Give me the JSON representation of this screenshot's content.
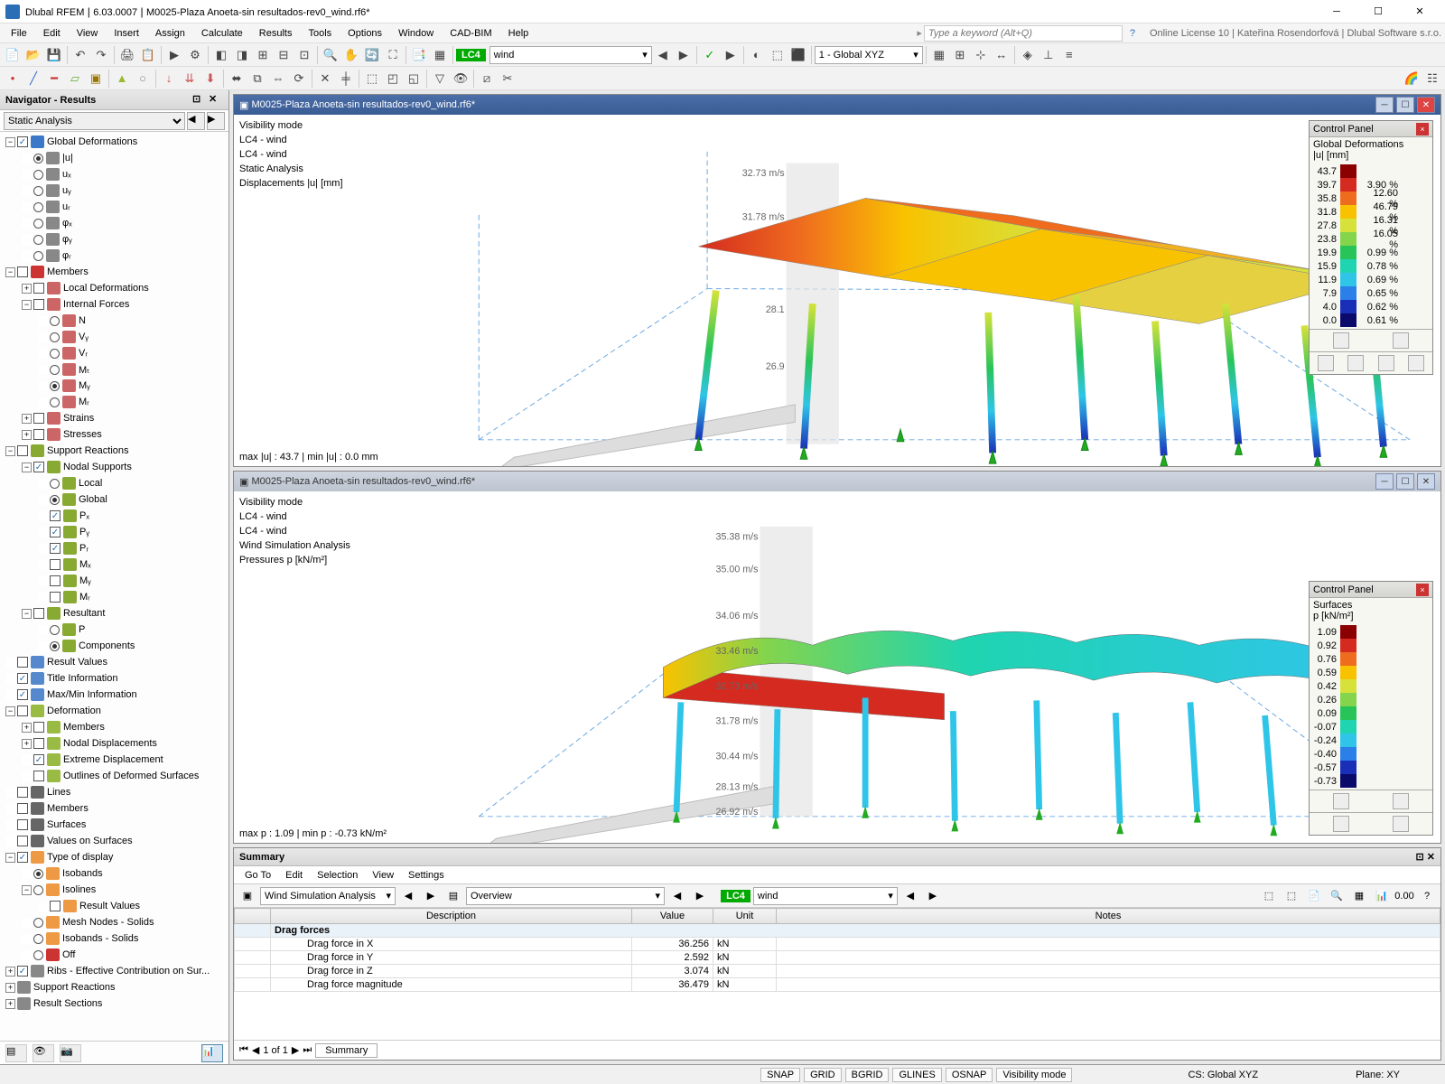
{
  "titlebar": {
    "app": "Dlubal RFEM",
    "version": "6.03.0007",
    "file": "M0025-Plaza Anoeta-sin resultados-rev0_wind.rf6*"
  },
  "menus": [
    "File",
    "Edit",
    "View",
    "Insert",
    "Assign",
    "Calculate",
    "Results",
    "Tools",
    "Options",
    "Window",
    "CAD-BIM",
    "Help"
  ],
  "search_placeholder": "Type a keyword (Alt+Q)",
  "license": "Online License 10 | Kateřina Rosendorfová | Dlubal Software s.r.o.",
  "toolbar1": {
    "lc_num": "LC4",
    "lc_name": "wind",
    "global": "1 - Global XYZ"
  },
  "navigator": {
    "title": "Navigator - Results",
    "combo": "Static Analysis",
    "tree": [
      {
        "d": 0,
        "exp": "-",
        "cb": "on",
        "ic": "#3c78c8",
        "lbl": "Global Deformations"
      },
      {
        "d": 1,
        "rb": "on",
        "ic": "#888",
        "lbl": "|u|"
      },
      {
        "d": 1,
        "rb": "off",
        "ic": "#888",
        "lbl": "uₓ"
      },
      {
        "d": 1,
        "rb": "off",
        "ic": "#888",
        "lbl": "uᵧ"
      },
      {
        "d": 1,
        "rb": "off",
        "ic": "#888",
        "lbl": "uᵣ"
      },
      {
        "d": 1,
        "rb": "off",
        "ic": "#888",
        "lbl": "φₓ"
      },
      {
        "d": 1,
        "rb": "off",
        "ic": "#888",
        "lbl": "φᵧ"
      },
      {
        "d": 1,
        "rb": "off",
        "ic": "#888",
        "lbl": "φᵣ"
      },
      {
        "d": 0,
        "exp": "-",
        "cb": "off",
        "ic": "#c33",
        "lbl": "Members"
      },
      {
        "d": 1,
        "exp": "+",
        "cb": "off",
        "ic": "#c66",
        "lbl": "Local Deformations"
      },
      {
        "d": 1,
        "exp": "-",
        "cb": "off",
        "ic": "#c66",
        "lbl": "Internal Forces"
      },
      {
        "d": 2,
        "rb": "off",
        "ic": "#c66",
        "lbl": "N"
      },
      {
        "d": 2,
        "rb": "off",
        "ic": "#c66",
        "lbl": "Vᵧ"
      },
      {
        "d": 2,
        "rb": "off",
        "ic": "#c66",
        "lbl": "Vᵣ"
      },
      {
        "d": 2,
        "rb": "off",
        "ic": "#c66",
        "lbl": "Mₜ"
      },
      {
        "d": 2,
        "rb": "on",
        "ic": "#c66",
        "lbl": "Mᵧ"
      },
      {
        "d": 2,
        "rb": "off",
        "ic": "#c66",
        "lbl": "Mᵣ"
      },
      {
        "d": 1,
        "exp": "+",
        "cb": "off",
        "ic": "#c66",
        "lbl": "Strains"
      },
      {
        "d": 1,
        "exp": "+",
        "cb": "off",
        "ic": "#c66",
        "lbl": "Stresses"
      },
      {
        "d": 0,
        "exp": "-",
        "cb": "off",
        "ic": "#8a3",
        "lbl": "Support Reactions"
      },
      {
        "d": 1,
        "exp": "-",
        "cb": "on",
        "ic": "#8a3",
        "lbl": "Nodal Supports"
      },
      {
        "d": 2,
        "rb": "off",
        "ic": "#8a3",
        "lbl": "Local"
      },
      {
        "d": 2,
        "rb": "on",
        "ic": "#8a3",
        "lbl": "Global"
      },
      {
        "d": 2,
        "cb": "on",
        "ic": "#8a3",
        "lbl": "Pₓ"
      },
      {
        "d": 2,
        "cb": "on",
        "ic": "#8a3",
        "lbl": "Pᵧ"
      },
      {
        "d": 2,
        "cb": "on",
        "ic": "#8a3",
        "lbl": "Pᵣ"
      },
      {
        "d": 2,
        "cb": "off",
        "ic": "#8a3",
        "lbl": "Mₓ"
      },
      {
        "d": 2,
        "cb": "off",
        "ic": "#8a3",
        "lbl": "Mᵧ"
      },
      {
        "d": 2,
        "cb": "off",
        "ic": "#8a3",
        "lbl": "Mᵣ"
      },
      {
        "d": 1,
        "exp": "-",
        "cb": "off",
        "ic": "#8a3",
        "lbl": "Resultant"
      },
      {
        "d": 2,
        "rb": "off",
        "ic": "#8a3",
        "lbl": "P"
      },
      {
        "d": 2,
        "rb": "on",
        "ic": "#8a3",
        "lbl": "Components"
      },
      {
        "d": 0,
        "cb": "off",
        "ic": "#58c",
        "lbl": "Result Values"
      },
      {
        "d": 0,
        "cb": "on",
        "ic": "#58c",
        "lbl": "Title Information"
      },
      {
        "d": 0,
        "cb": "on",
        "ic": "#58c",
        "lbl": "Max/Min Information"
      },
      {
        "d": 0,
        "exp": "-",
        "cb": "off",
        "ic": "#9b4",
        "lbl": "Deformation"
      },
      {
        "d": 1,
        "exp": "+",
        "cb": "off",
        "ic": "#9b4",
        "lbl": "Members"
      },
      {
        "d": 1,
        "exp": "+",
        "cb": "off",
        "ic": "#9b4",
        "lbl": "Nodal Displacements"
      },
      {
        "d": 1,
        "cb": "on",
        "ic": "#9b4",
        "lbl": "Extreme Displacement"
      },
      {
        "d": 1,
        "cb": "off",
        "ic": "#9b4",
        "lbl": "Outlines of Deformed Surfaces"
      },
      {
        "d": 0,
        "cb": "off",
        "ic": "#666",
        "lbl": "Lines"
      },
      {
        "d": 0,
        "cb": "off",
        "ic": "#666",
        "lbl": "Members"
      },
      {
        "d": 0,
        "cb": "off",
        "ic": "#666",
        "lbl": "Surfaces"
      },
      {
        "d": 0,
        "cb": "off",
        "ic": "#666",
        "lbl": "Values on Surfaces"
      },
      {
        "d": 0,
        "exp": "-",
        "cb": "on",
        "ic": "#e94",
        "lbl": "Type of display"
      },
      {
        "d": 1,
        "rb": "on",
        "ic": "#e94",
        "lbl": "Isobands"
      },
      {
        "d": 1,
        "exp": "-",
        "rb": "off",
        "ic": "#e94",
        "lbl": "Isolines"
      },
      {
        "d": 2,
        "cb": "off",
        "ic": "#e94",
        "lbl": "Result Values"
      },
      {
        "d": 1,
        "rb": "off",
        "ic": "#e94",
        "lbl": "Mesh Nodes - Solids"
      },
      {
        "d": 1,
        "rb": "off",
        "ic": "#e94",
        "lbl": "Isobands - Solids"
      },
      {
        "d": 1,
        "rb": "off",
        "ic": "#c33",
        "lbl": "Off"
      },
      {
        "d": 0,
        "exp": "+",
        "cb": "on",
        "ic": "#888",
        "lbl": "Ribs - Effective Contribution on Sur..."
      },
      {
        "d": 0,
        "exp": "+",
        "ic": "#888",
        "lbl": "Support Reactions"
      },
      {
        "d": 0,
        "exp": "+",
        "ic": "#888",
        "lbl": "Result Sections"
      }
    ]
  },
  "view1": {
    "title": "M0025-Plaza Anoeta-sin resultados-rev0_wind.rf6*",
    "overlay": [
      "Visibility mode",
      "LC4 - wind",
      "LC4 - wind",
      "Static Analysis",
      "Displacements |u| [mm]"
    ],
    "bottom": "max |u| : 43.7 | min |u| : 0.0 mm",
    "wind_labels": [
      "32.73 m/s",
      "31.78 m/s",
      "28.1",
      "26.9"
    ],
    "panel": {
      "title": "Control Panel",
      "sub": "Global Deformations\n|u| [mm]",
      "rows": [
        {
          "v": "43.7",
          "c": "#8b0000",
          "p": ""
        },
        {
          "v": "39.7",
          "c": "#d42a1f",
          "p": "3.90 %"
        },
        {
          "v": "35.8",
          "c": "#ef6c1f",
          "p": "12.60 %"
        },
        {
          "v": "31.8",
          "c": "#f9c200",
          "p": "46.79 %"
        },
        {
          "v": "27.8",
          "c": "#d6e23a",
          "p": "16.31 %"
        },
        {
          "v": "23.8",
          "c": "#84d44c",
          "p": "16.05 %"
        },
        {
          "v": "19.9",
          "c": "#28c45a",
          "p": "0.99 %"
        },
        {
          "v": "15.9",
          "c": "#1fd4b0",
          "p": "0.78 %"
        },
        {
          "v": "11.9",
          "c": "#2fc5e8",
          "p": "0.69 %"
        },
        {
          "v": "7.9",
          "c": "#2a7fe8",
          "p": "0.65 %"
        },
        {
          "v": "4.0",
          "c": "#1a2fb8",
          "p": "0.62 %"
        },
        {
          "v": "0.0",
          "c": "#0a0a6a",
          "p": "0.61 %"
        }
      ]
    }
  },
  "view2": {
    "title": "M0025-Plaza Anoeta-sin resultados-rev0_wind.rf6*",
    "overlay": [
      "Visibility mode",
      "LC4 - wind",
      "LC4 - wind",
      "Wind Simulation Analysis",
      "Pressures p [kN/m²]"
    ],
    "bottom": "max p : 1.09 | min p : -0.73 kN/m²",
    "wind_labels": [
      "35.38 m/s",
      "35.00 m/s",
      "34.06 m/s",
      "33.46 m/s",
      "32.73 m/s",
      "31.78 m/s",
      "30.44 m/s",
      "28.13 m/s",
      "26.92 m/s"
    ],
    "panel": {
      "title": "Control Panel",
      "sub": "Surfaces\np [kN/m²]",
      "rows": [
        {
          "v": "1.09",
          "c": "#8b0000"
        },
        {
          "v": "0.92",
          "c": "#d42a1f"
        },
        {
          "v": "0.76",
          "c": "#ef6c1f"
        },
        {
          "v": "0.59",
          "c": "#f9c200"
        },
        {
          "v": "0.42",
          "c": "#d6e23a"
        },
        {
          "v": "0.26",
          "c": "#84d44c"
        },
        {
          "v": "0.09",
          "c": "#28c45a"
        },
        {
          "v": "-0.07",
          "c": "#1fd4b0"
        },
        {
          "v": "-0.24",
          "c": "#2fc5e8"
        },
        {
          "v": "-0.40",
          "c": "#2a7fe8"
        },
        {
          "v": "-0.57",
          "c": "#1a2fb8"
        },
        {
          "v": "-0.73",
          "c": "#0a0a6a"
        }
      ]
    }
  },
  "summary": {
    "title": "Summary",
    "menus": [
      "Go To",
      "Edit",
      "Selection",
      "View",
      "Settings"
    ],
    "combo1": "Wind Simulation Analysis",
    "combo2": "Overview",
    "lc_num": "LC4",
    "lc_name": "wind",
    "headers": [
      "",
      "Description",
      "Value",
      "Unit",
      "Notes"
    ],
    "cat": "Drag forces",
    "rows": [
      [
        "",
        "Drag force in X",
        "36.256",
        "kN",
        ""
      ],
      [
        "",
        "Drag force in Y",
        "2.592",
        "kN",
        ""
      ],
      [
        "",
        "Drag force in Z",
        "3.074",
        "kN",
        ""
      ],
      [
        "",
        "Drag force magnitude",
        "36.479",
        "kN",
        ""
      ]
    ],
    "pager": "1 of 1",
    "tab": "Summary"
  },
  "status": {
    "toggles": [
      "SNAP",
      "GRID",
      "BGRID",
      "GLINES",
      "OSNAP",
      "Visibility mode"
    ],
    "cs": "CS: Global XYZ",
    "plane": "Plane: XY"
  }
}
